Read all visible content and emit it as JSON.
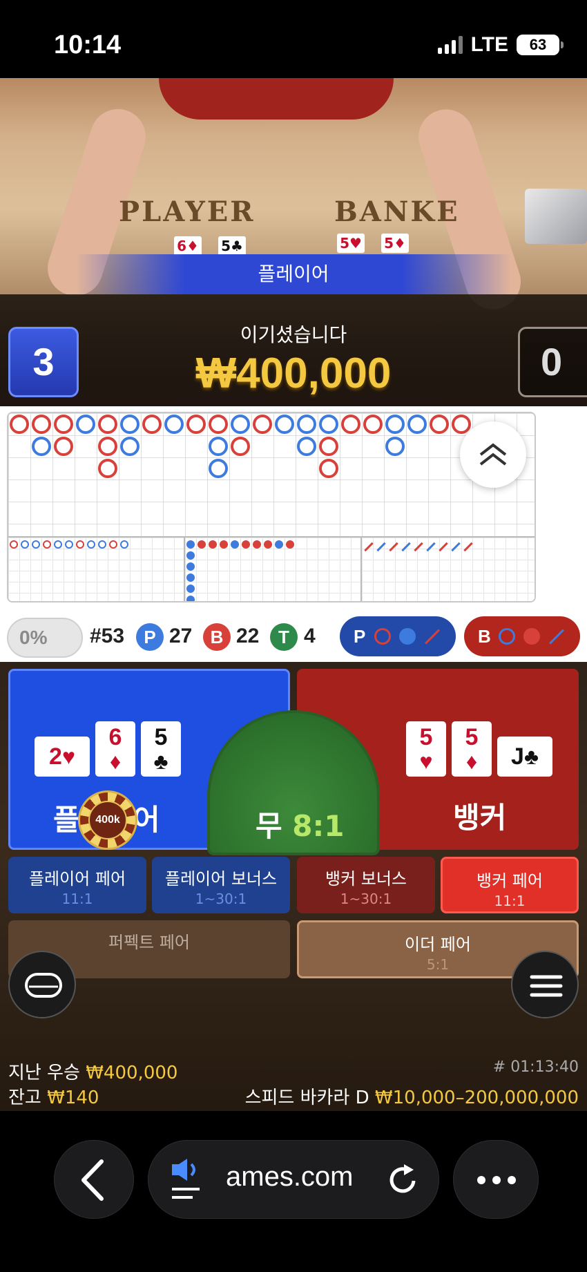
{
  "status_bar": {
    "time": "10:14",
    "network": "LTE",
    "battery": "63"
  },
  "video": {
    "table_player_label": "PLAYER",
    "table_banker_label": "BANKE",
    "winner_banner": "플레이어",
    "player_score": "3",
    "banker_score": "0",
    "win_message": "이기셨습니다",
    "win_amount": "₩400,000"
  },
  "roadmap": {
    "bead_column": [
      "B",
      "B",
      "B",
      "P",
      "P",
      "B"
    ]
  },
  "stats": {
    "percent_toggle": "0%",
    "round_number": "#53",
    "player_label": "P",
    "player_count": "27",
    "banker_label": "B",
    "banker_count": "22",
    "tie_label": "T",
    "tie_count": "4",
    "player_ask": "P",
    "banker_ask": "B"
  },
  "bets": {
    "player_label": "플레이어",
    "tie_label": "무",
    "tie_odds": "8:1",
    "banker_label": "뱅커",
    "chip_value": "400k",
    "player_cards": [
      {
        "rank": "2",
        "suit": "♥",
        "color": "#c8102e",
        "sideways": true
      },
      {
        "rank": "6",
        "suit": "♦",
        "color": "#c8102e",
        "sideways": false
      },
      {
        "rank": "5",
        "suit": "♣",
        "color": "#111111",
        "sideways": false
      }
    ],
    "banker_cards": [
      {
        "rank": "5",
        "suit": "♥",
        "color": "#c8102e",
        "sideways": false
      },
      {
        "rank": "5",
        "suit": "♦",
        "color": "#c8102e",
        "sideways": false
      },
      {
        "rank": "J",
        "suit": "♣",
        "color": "#111111",
        "sideways": true
      }
    ],
    "side_bets": {
      "player_pair": {
        "name": "플레이어 페어",
        "odds": "11:1"
      },
      "player_bonus": {
        "name": "플레이어 보너스",
        "odds": "1~30:1"
      },
      "banker_bonus": {
        "name": "뱅커 보너스",
        "odds": "1~30:1"
      },
      "banker_pair": {
        "name": "뱅커 페어",
        "odds": "11:1"
      },
      "perfect_pair": {
        "name": "퍼펙트 페어"
      },
      "either_pair": {
        "name": "이더 페어",
        "odds": "5:1"
      }
    }
  },
  "footer": {
    "last_win_label": "지난 우승",
    "last_win_value": "₩400,000",
    "balance_label": "잔고",
    "balance_value": "₩140",
    "game_id": "# 01:13:40",
    "table_name": "스피드 바카라 D",
    "limits": "₩10,000–200,000,000"
  },
  "browser": {
    "url": "ames.com"
  },
  "colors": {
    "player_blue": "#1f4fe0",
    "banker_red": "#a5221c",
    "tie_green": "#2e7a30",
    "gold": "#f4c840"
  }
}
